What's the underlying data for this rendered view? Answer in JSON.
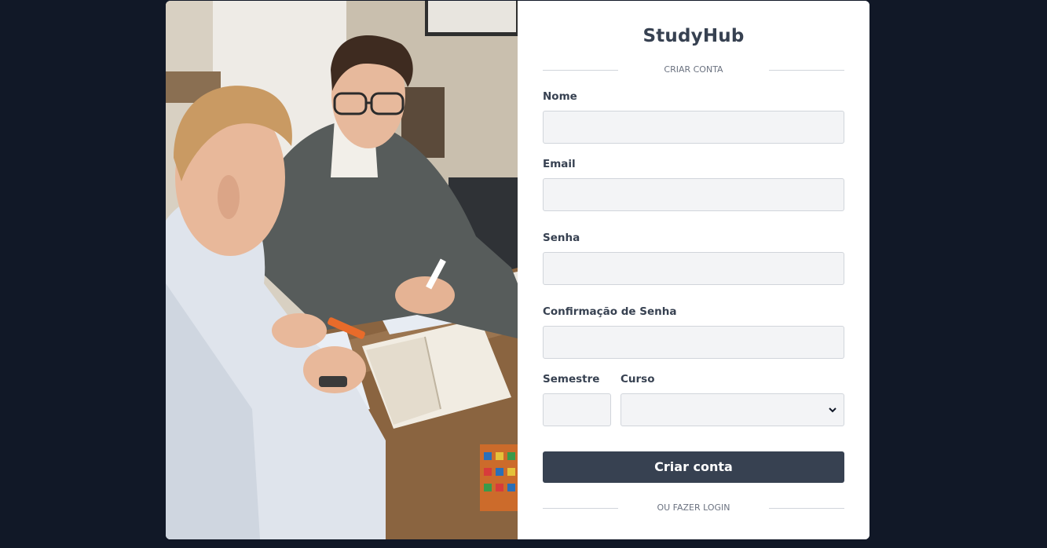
{
  "brand": {
    "name": "StudyHub"
  },
  "form": {
    "section_title": "CRIAR CONTA",
    "fields": {
      "nome": {
        "label": "Nome",
        "value": ""
      },
      "email": {
        "label": "Email",
        "value": ""
      },
      "senha": {
        "label": "Senha",
        "value": ""
      },
      "confirmacao": {
        "label": "Confirmação de Senha",
        "value": ""
      },
      "semestre": {
        "label": "Semestre",
        "value": ""
      },
      "curso": {
        "label": "Curso",
        "selected": ""
      }
    },
    "submit_label": "Criar conta",
    "login_divider": "OU FAZER LOGIN"
  },
  "colors": {
    "page_background": "#111827",
    "card_background": "#ffffff",
    "button_background": "#374151",
    "input_background": "#f3f4f6",
    "input_border": "#d1d5db"
  }
}
